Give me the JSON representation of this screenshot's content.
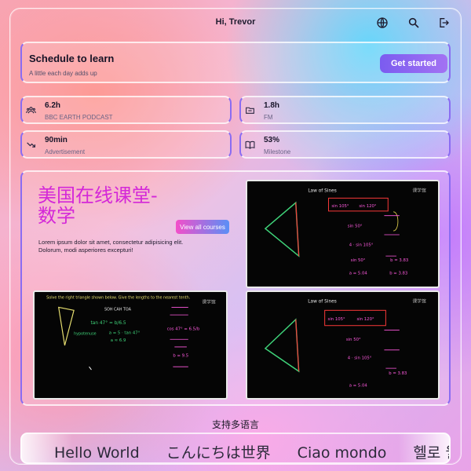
{
  "header": {
    "greeting": "Hi, Trevor",
    "icons": [
      "globe-icon",
      "search-icon",
      "logout-icon"
    ]
  },
  "hero": {
    "title": "Schedule to learn",
    "subtitle": "A little each day adds up",
    "cta_label": "Get started"
  },
  "stats": [
    {
      "value": "6.2h",
      "label": "BBC EARTH PODCAST",
      "icon": "users-icon"
    },
    {
      "value": "1.8h",
      "label": "FM",
      "icon": "folder-icon"
    },
    {
      "value": "90min",
      "label": "Advertisement",
      "icon": "trend-down-icon"
    },
    {
      "value": "53%",
      "label": "Milestone",
      "icon": "book-icon"
    }
  ],
  "courses": {
    "title": "美国在线课堂-数学",
    "description": "Lorem ipsum dolor sit amet, consectetur adipisicing elit. Dolorum, modi asperiores excepturi!",
    "view_all_label": "View all courses",
    "boards": [
      {
        "heading": "Law of Sines",
        "watermark": "课学馆",
        "lines": [
          "sin 105°",
          "sin 120°",
          "sin 50°",
          "4 · sin 105°",
          "sin 50°",
          "b = 3.83",
          "sin 105°",
          "a ≈ 5.04",
          "b ≈ 3.83"
        ]
      },
      {
        "heading": "Solve the right triangle shown below. Give the lengths to the nearest tenth.",
        "watermark": "课学馆",
        "lines": [
          "SOH CAH TOA",
          "tan 47° = b/6.5",
          "a = 5 · tan 47°",
          "a ≈ 6.9",
          "cos 47° = 6.5/b",
          "b ≈ 9.5",
          "hypotenuse"
        ]
      },
      {
        "heading": "Law of Sines",
        "watermark": "课学馆",
        "lines": [
          "sin 105°",
          "sin 120°",
          "sin 50°",
          "4 · sin 105°",
          "b = 3.83",
          "a ≈ 5.04"
        ]
      }
    ]
  },
  "languages": {
    "title": "支持多语言",
    "items": [
      "Hello World",
      "こんにちは世界",
      "Ciao mondo",
      "헬로 월드"
    ]
  },
  "colors": {
    "accent": "#8a6cf2",
    "title_magenta": "#d428d8"
  }
}
